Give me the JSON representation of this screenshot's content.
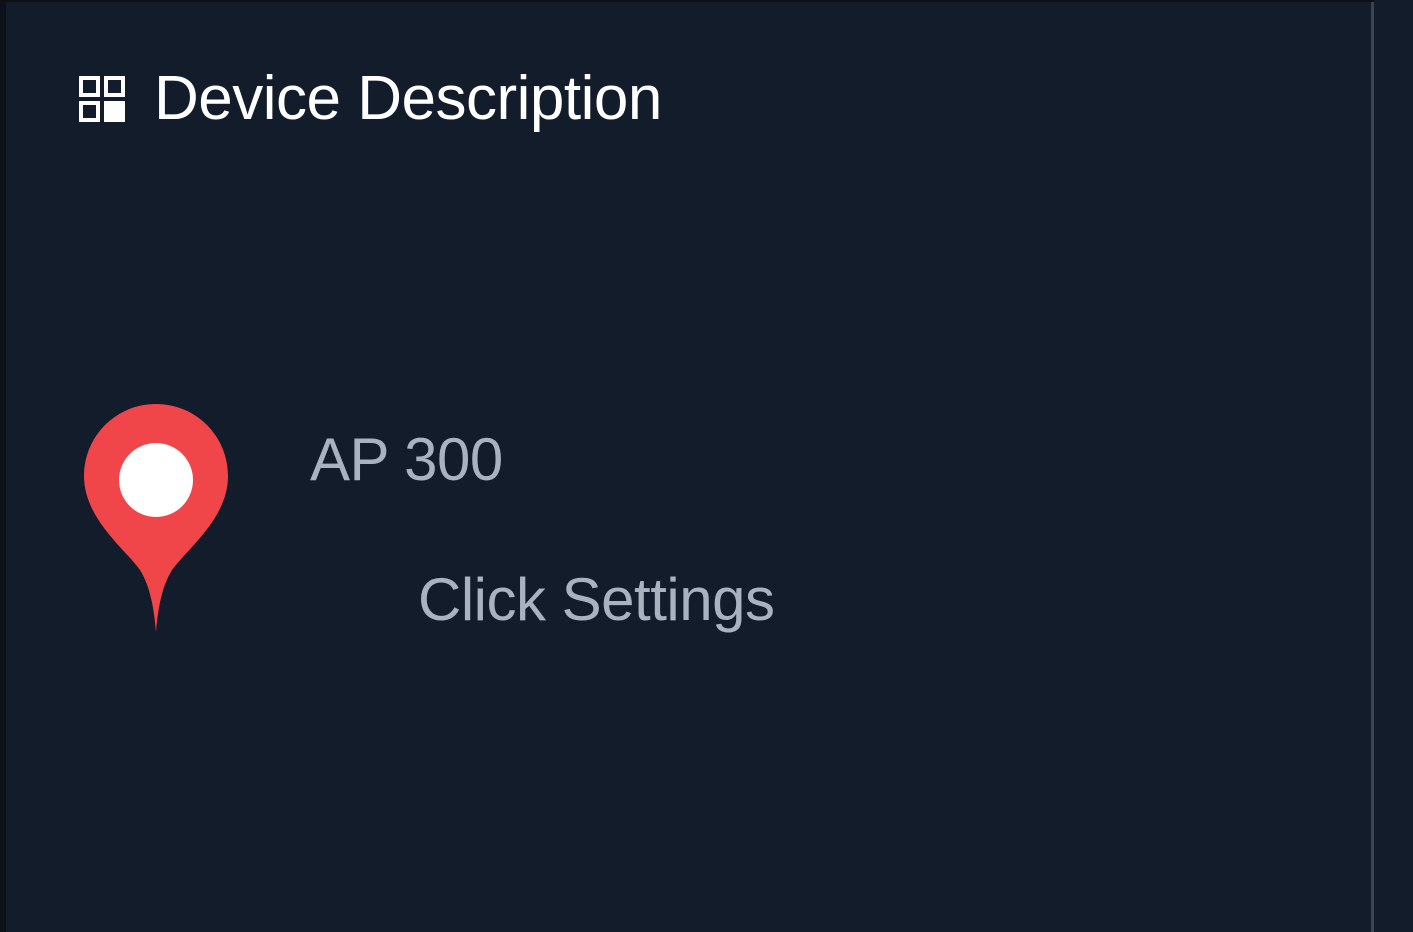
{
  "panel": {
    "title": "Device Description",
    "title_icon": "grid-icon"
  },
  "device": {
    "name": "AP 300",
    "action_label": "Click Settings",
    "marker_icon": "location-pin-icon",
    "marker_color": "#f0464a"
  },
  "colors": {
    "background": "#131c2b",
    "title_text": "#ffffff",
    "body_text": "#a9b2bf",
    "divider": "#3a4353"
  }
}
